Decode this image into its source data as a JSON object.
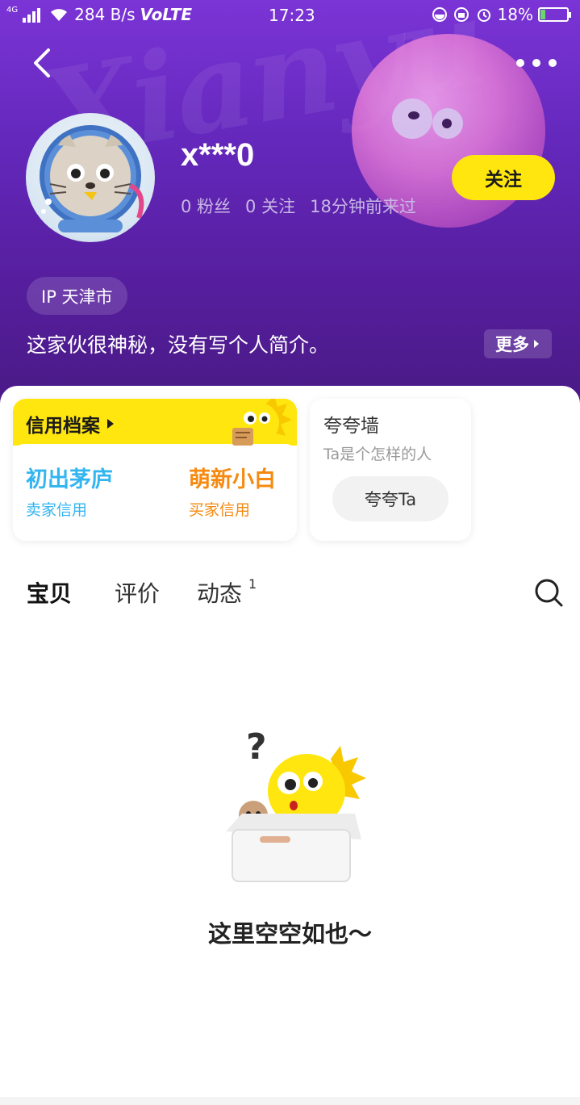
{
  "status_bar": {
    "network_type": "4G",
    "speed": "284 B/s",
    "volte": "VoLTE",
    "time": "17:23",
    "battery": "18%",
    "battery_level": 0.18
  },
  "header": {
    "watermark": "Xianyu"
  },
  "profile": {
    "username": "x***0",
    "fans": "0 粉丝",
    "following": "0 关注",
    "last_seen": "18分钟前来过",
    "follow_label": "关注",
    "ip_location": "IP 天津市",
    "bio": "这家伙很神秘，没有写个人简介。",
    "more_label": "更多"
  },
  "credit": {
    "title": "信用档案",
    "seller_level": "初出茅庐",
    "seller_label": "卖家信用",
    "buyer_level": "萌新小白",
    "buyer_label": "买家信用"
  },
  "praise": {
    "title": "夸夸墙",
    "subtitle": "Ta是个怎样的人",
    "button": "夸夸Ta"
  },
  "tabs": [
    {
      "label": "宝贝"
    },
    {
      "label": "评价"
    },
    {
      "label": "动态"
    }
  ],
  "dynamics_badge": "1",
  "empty_text": "这里空空如也～",
  "colors": {
    "accent_yellow": "#ffe60f",
    "header_purple": "#6428bc",
    "seller_blue": "#33b5f0",
    "buyer_orange": "#f58a10"
  }
}
